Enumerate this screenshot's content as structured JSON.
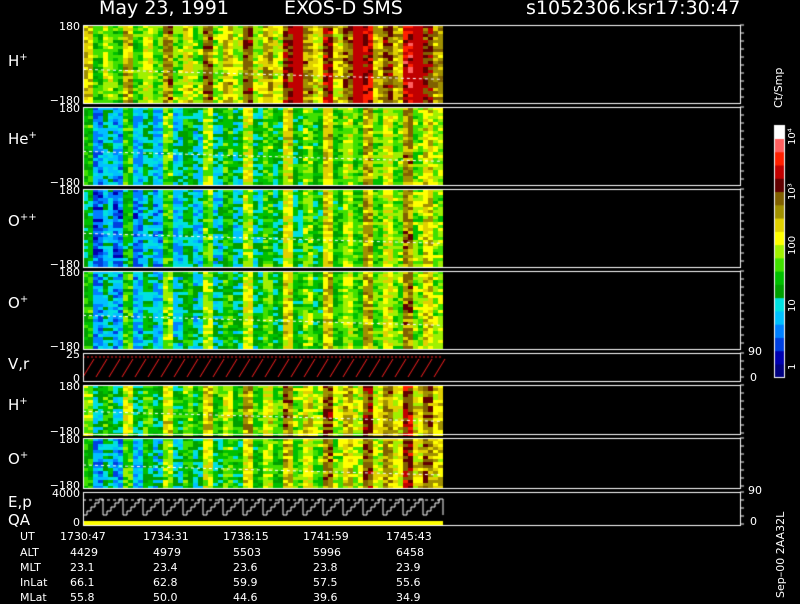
{
  "header": {
    "date": "May 23, 1991",
    "instrument": "EXOS-D SMS",
    "file": "s1052306.ksr",
    "time": "17:30:47"
  },
  "colorbar": {
    "unit": "Ct/Smp",
    "ticks": [
      "10⁴",
      "10³",
      "100",
      "10",
      "1"
    ],
    "colors": [
      "#000080",
      "#0000b0",
      "#0040e0",
      "#0080ff",
      "#00c0ff",
      "#00e0e0",
      "#00a000",
      "#00c000",
      "#40e000",
      "#a0f000",
      "#ffff00",
      "#e0d000",
      "#a09000",
      "#806000",
      "#600000",
      "#c00000",
      "#ff2000",
      "#ff6060",
      "#ffffff"
    ]
  },
  "side_note": "Sep–00 2AA32L",
  "panels": [
    {
      "id": "h-plus",
      "label": "H",
      "sup": "+",
      "ymax": "180",
      "ymin": "−180",
      "seed": 3,
      "mode": "h"
    },
    {
      "id": "he-plus",
      "label": "He",
      "sup": "+",
      "ymax": "180",
      "ymin": "−180",
      "seed": 7,
      "mode": "he"
    },
    {
      "id": "o-plusplus",
      "label": "O",
      "sup": "++",
      "ymax": "180",
      "ymin": "−180",
      "seed": 11,
      "mode": "opp"
    },
    {
      "id": "o-plus",
      "label": "O",
      "sup": "+",
      "ymax": "180",
      "ymin": "−180",
      "seed": 13,
      "mode": "op"
    },
    {
      "id": "vr",
      "label": "V,r",
      "ymax": "25",
      "ymin": "0",
      "right_top": "90",
      "right_bot": "0"
    },
    {
      "id": "h-plus-2",
      "label": "H",
      "sup": "+",
      "ymax": "180",
      "ymin": "−180",
      "seed": 17,
      "mode": "h2"
    },
    {
      "id": "o-plus-2",
      "label": "O",
      "sup": "+",
      "ymax": "180",
      "ymin": "−180",
      "seed": 19,
      "mode": "o2"
    },
    {
      "id": "ep",
      "label": "E,p",
      "label2": "QA",
      "ymax": "4000",
      "ymin": "0",
      "right_top": "90",
      "right_bot": "0"
    }
  ],
  "ut_table": {
    "row_labels": [
      "UT",
      "ALT",
      "MLT",
      "InLat",
      "MLat"
    ],
    "columns": [
      [
        "1730:47",
        "4429",
        "23.1",
        "66.1",
        "55.8"
      ],
      [
        "1734:31",
        "4979",
        "23.4",
        "62.8",
        "50.0"
      ],
      [
        "1738:15",
        "5503",
        "23.6",
        "59.9",
        "44.6"
      ],
      [
        "1741:59",
        "5996",
        "23.8",
        "57.5",
        "39.6"
      ],
      [
        "1745:43",
        "6458",
        "23.9",
        "55.6",
        "34.9"
      ]
    ]
  }
}
